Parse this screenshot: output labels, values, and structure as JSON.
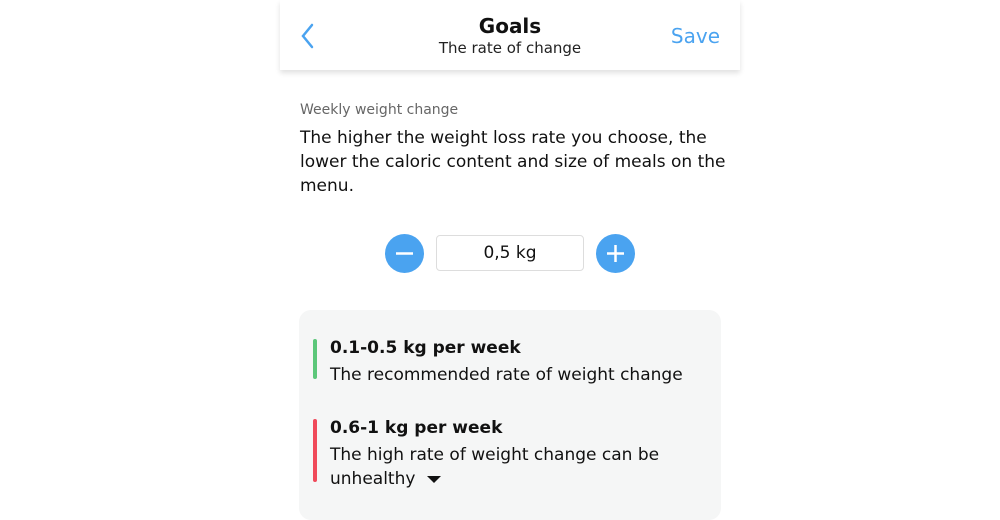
{
  "header": {
    "title": "Goals",
    "subtitle": "The rate of change",
    "save_label": "Save",
    "back_icon": "chevron-left-icon"
  },
  "section": {
    "label": "Weekly weight change",
    "description": "The higher the weight loss rate you choose, the lower the caloric content and size of meals on the menu."
  },
  "stepper": {
    "value": "0,5 kg",
    "decrement_icon": "minus-icon",
    "increment_icon": "plus-icon"
  },
  "rates": [
    {
      "title": "0.1-0.5 kg per week",
      "text": "The recommended rate of weight change",
      "color": "#5cc77a"
    },
    {
      "title": "0.6-1 kg per week",
      "text": "The high rate of weight change can be unhealthy",
      "color": "#f04a5a"
    }
  ],
  "colors": {
    "accent": "#4aa3f0"
  }
}
